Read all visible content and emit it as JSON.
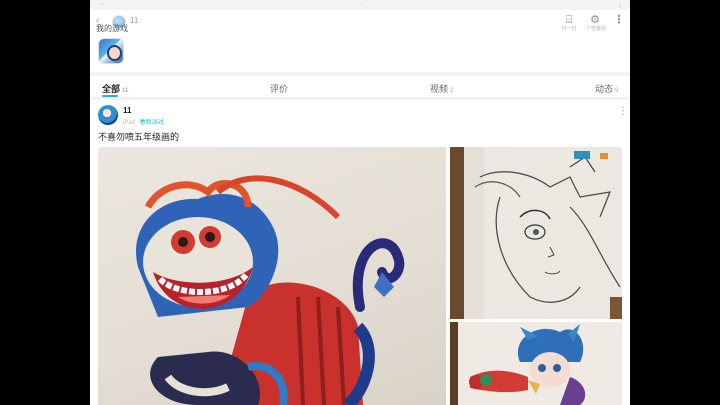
{
  "header": {
    "user_name": "11",
    "my_games_label": "我的游戏",
    "scan_caption": "扫一扫",
    "settings_caption": "个性装扮"
  },
  "tabs": [
    {
      "label": "全部",
      "count": "11"
    },
    {
      "label": "评价",
      "count": ""
    },
    {
      "label": "视频",
      "count": "2"
    },
    {
      "label": "动态",
      "count": "9"
    }
  ],
  "post": {
    "author": "11",
    "device": "iPad",
    "tag": "春新派对",
    "title": "不喜勿喷五年级画的"
  },
  "colors": {
    "accent": "#1fb8c8",
    "background": "#f3f3f3"
  },
  "icons": [
    "back-arrow-icon",
    "scan-icon",
    "settings-icon",
    "more-icon"
  ]
}
